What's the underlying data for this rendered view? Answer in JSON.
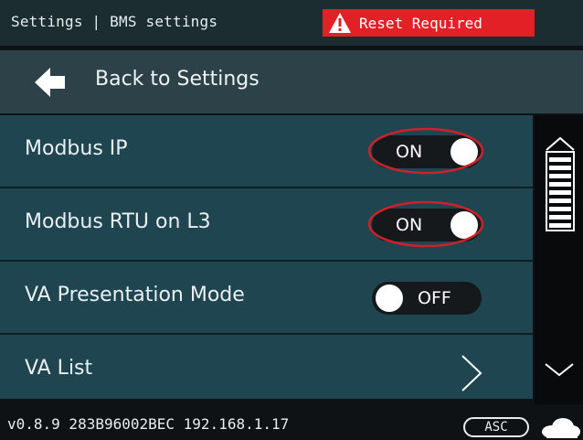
{
  "header": {
    "title": "Settings | BMS settings",
    "alert_text": "Reset Required",
    "alert_color": "#e32026"
  },
  "back": {
    "label": "Back to Settings",
    "icon": "arrow-left-icon"
  },
  "rows": [
    {
      "label": "Modbus IP",
      "control": "toggle",
      "state": "ON",
      "highlighted": true
    },
    {
      "label": "Modbus RTU on L3",
      "control": "toggle",
      "state": "ON",
      "highlighted": true
    },
    {
      "label": "VA Presentation Mode",
      "control": "toggle",
      "state": "OFF",
      "highlighted": false
    },
    {
      "label": "VA List",
      "control": "chevron",
      "icon": "chevron-right-icon"
    }
  ],
  "scrollbar": {
    "up_icon": "scroll-up-icon",
    "down_icon": "chevron-down-icon"
  },
  "footer": {
    "info": "v0.8.9  283B96002BEC  192.168.1.17",
    "badge": "ASC",
    "cloud_icon": "cloud-icon"
  },
  "colors": {
    "header_bg": "#1c2d32",
    "back_bar_bg": "#2c4148",
    "row_bg": "#1e4550",
    "highlight_ring": "#d0202a"
  }
}
